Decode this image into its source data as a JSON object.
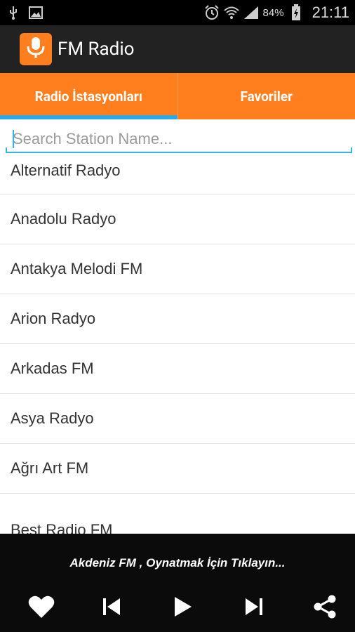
{
  "status_bar": {
    "battery_percent": "84%",
    "time": "21:11",
    "icons": [
      "usb-icon",
      "image-icon",
      "alarm-icon",
      "wifi-icon",
      "signal-icon",
      "battery-charging-icon"
    ]
  },
  "app": {
    "title": "FM Radio",
    "icon": "microphone-icon",
    "accent_color": "#ff7e1d",
    "highlight_color": "#2fa9e4"
  },
  "tabs": [
    {
      "label": "Radio İstasyonları",
      "active": true
    },
    {
      "label": "Favoriler",
      "active": false
    }
  ],
  "search": {
    "placeholder": "Search Station Name...",
    "value": ""
  },
  "stations": [
    "Alternatif Radyo",
    "Anadolu Radyo",
    "Antakya Melodi FM",
    "Arion Radyo",
    "Arkadas FM",
    "Asya Radyo",
    "Ağrı Art FM",
    "Best Radio FM"
  ],
  "player": {
    "now_playing": "Akdeniz FM , Oynatmak İçin Tıklayın...",
    "controls": [
      "heart-icon",
      "skip-previous-icon",
      "play-icon",
      "skip-next-icon",
      "share-icon"
    ]
  }
}
